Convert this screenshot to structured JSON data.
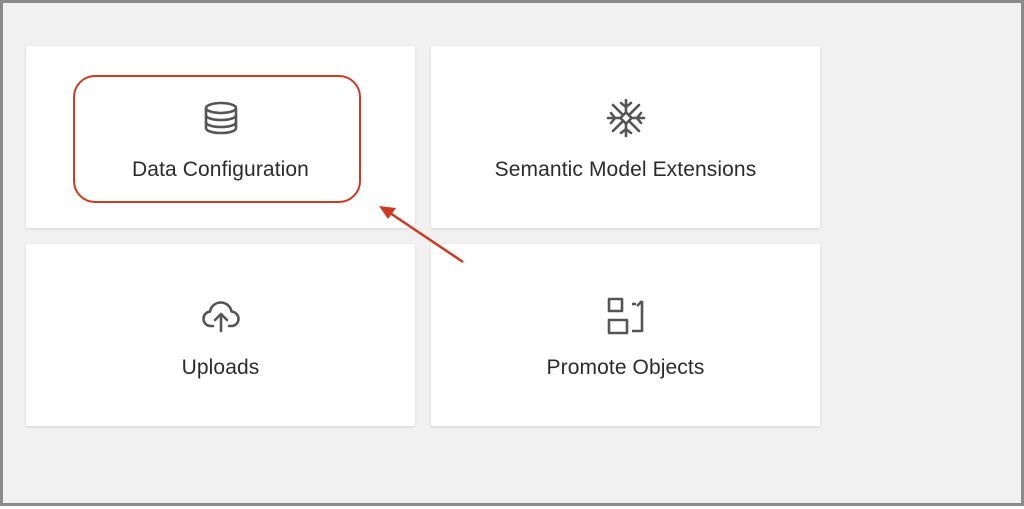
{
  "tiles": [
    {
      "label": "Data Configuration",
      "icon": "database-icon"
    },
    {
      "label": "Semantic Model Extensions",
      "icon": "snowflake-icon"
    },
    {
      "label": "Uploads",
      "icon": "cloud-upload-icon"
    },
    {
      "label": "Promote Objects",
      "icon": "promote-icon"
    }
  ],
  "colors": {
    "background": "#f1f1f1",
    "tile": "#ffffff",
    "text": "#2b2b2b",
    "icon": "#555555",
    "annotation": "#cc3a22"
  }
}
